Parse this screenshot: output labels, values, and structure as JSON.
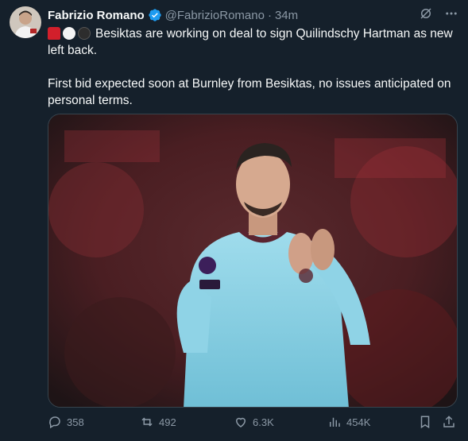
{
  "author": {
    "name": "Fabrizio Romano",
    "handle": "@FabrizioRomano",
    "separator": "·",
    "time": "34m"
  },
  "post": {
    "line1": "Besiktas are working on deal to sign Quilindschy Hartman as new",
    "line2": "left back.",
    "line3": "First bid expected soon at Burnley from Besiktas, no issues anticipated on",
    "line4": "personal terms."
  },
  "emojis": [
    "siren",
    "white-circle",
    "black-circle"
  ],
  "media": {
    "description_icons": [
      "player-photo"
    ],
    "colors": {
      "shirt": "#8fd3e6",
      "stands": "#7a1c22"
    }
  },
  "stats": {
    "replies": "358",
    "reposts": "492",
    "likes": "6.3K",
    "views": "454K"
  },
  "colors": {
    "background": "#15202b",
    "text": "#f7f9f9",
    "muted": "#8b98a5",
    "verified": "#1d9bf0"
  }
}
